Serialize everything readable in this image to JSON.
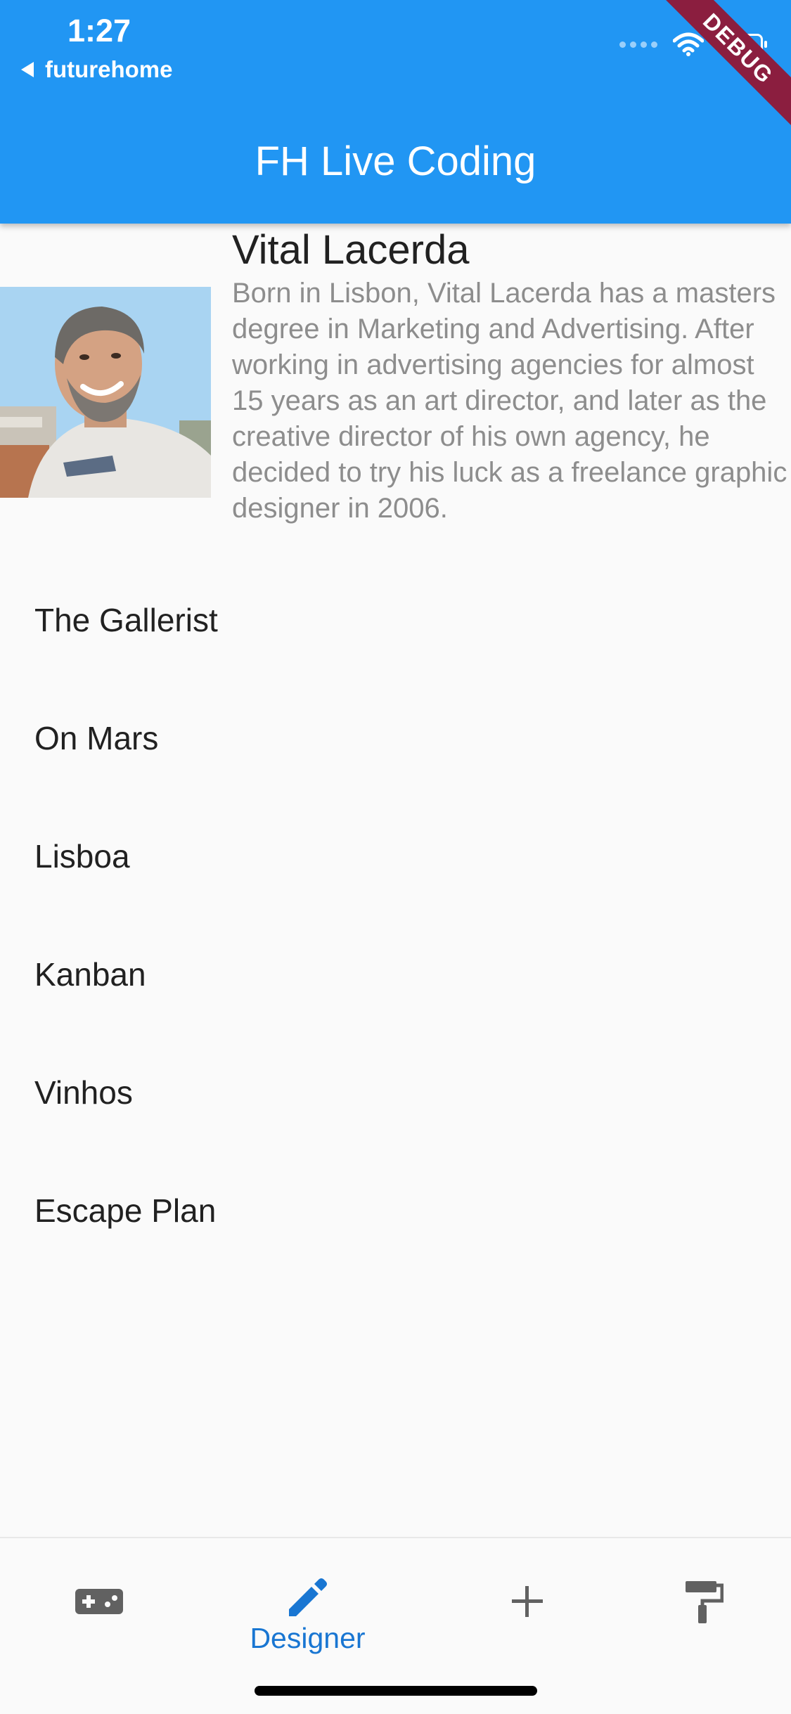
{
  "status_bar": {
    "time": "1:27",
    "back_app": "futurehome"
  },
  "appbar": {
    "title": "FH Live Coding",
    "debug_banner": "DEBUG"
  },
  "designer": {
    "name": "Vital Lacerda",
    "bio": "Born in Lisbon, Vital Lacerda has a masters degree in Marketing and Advertising. After working in advertising agencies for almost 15 years as an art director, and later as the creative director of his own agency, he decided to try his luck as a freelance graphic designer in 2006."
  },
  "games": [
    {
      "title": "The Gallerist"
    },
    {
      "title": "On Mars"
    },
    {
      "title": "Lisboa"
    },
    {
      "title": "Kanban"
    },
    {
      "title": "Vinhos"
    },
    {
      "title": "Escape Plan"
    }
  ],
  "bottom_nav": {
    "items": [
      {
        "icon": "gamepad-icon",
        "label": ""
      },
      {
        "icon": "pencil-icon",
        "label": "Designer",
        "active": true
      },
      {
        "icon": "plus-icon",
        "label": ""
      },
      {
        "icon": "paint-roller-icon",
        "label": ""
      }
    ]
  },
  "colors": {
    "primary": "#2196f3",
    "active_nav": "#1976d2",
    "inactive_nav": "#616161",
    "bio_text": "#8d8d8d",
    "debug_ribbon": "#8b1e3f"
  }
}
